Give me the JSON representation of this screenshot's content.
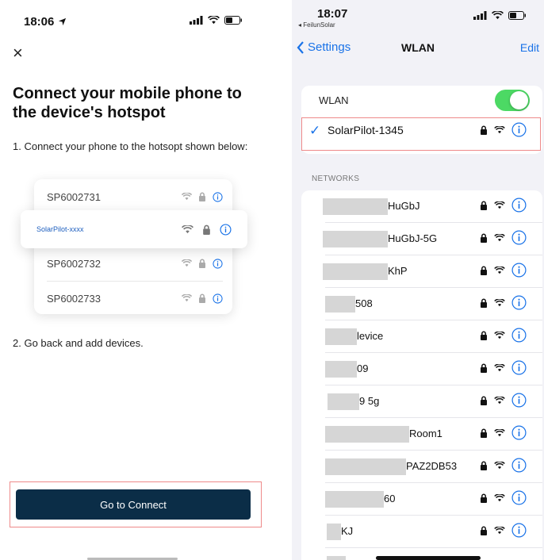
{
  "left": {
    "status": {
      "time": "18:06"
    },
    "close_label": "×",
    "headline": "Connect your mobile phone to the device's hotspot",
    "step1": "1. Connect your phone to the hotsopt shown below:",
    "networks": [
      "SP6002731",
      "SP6002732",
      "SP6002733"
    ],
    "selected_network": "SolarPilot-xxxx",
    "step2": "2. Go back and add devices.",
    "connect_button": "Go to Connect"
  },
  "right": {
    "status": {
      "time": "18:07",
      "back_app": "◂ FeilunSolar"
    },
    "nav": {
      "back_label": "Settings",
      "title": "WLAN",
      "edit_label": "Edit"
    },
    "wlan_label": "WLAN",
    "wlan_enabled": true,
    "current_network": "SolarPilot-1345",
    "networks_header": "NETWORKS",
    "networks": [
      "HuGbJ",
      "HuGbJ-5G",
      "KhP",
      "508",
      "levice",
      "09",
      "9 5g",
      "Room1",
      "PAZ2DB53",
      "60",
      "KJ",
      ""
    ]
  },
  "colors": {
    "accent": "#1a73e8",
    "button_bg": "#0b2d47",
    "toggle_on": "#4cd964",
    "highlight_outline": "#ee8a8a",
    "selected_text": "#1e5fbf"
  },
  "icons": [
    "location-arrow-icon",
    "signal-icon",
    "wifi-icon",
    "battery-icon",
    "lock-icon",
    "info-icon",
    "close-icon",
    "chevron-left-icon",
    "checkmark-icon"
  ]
}
